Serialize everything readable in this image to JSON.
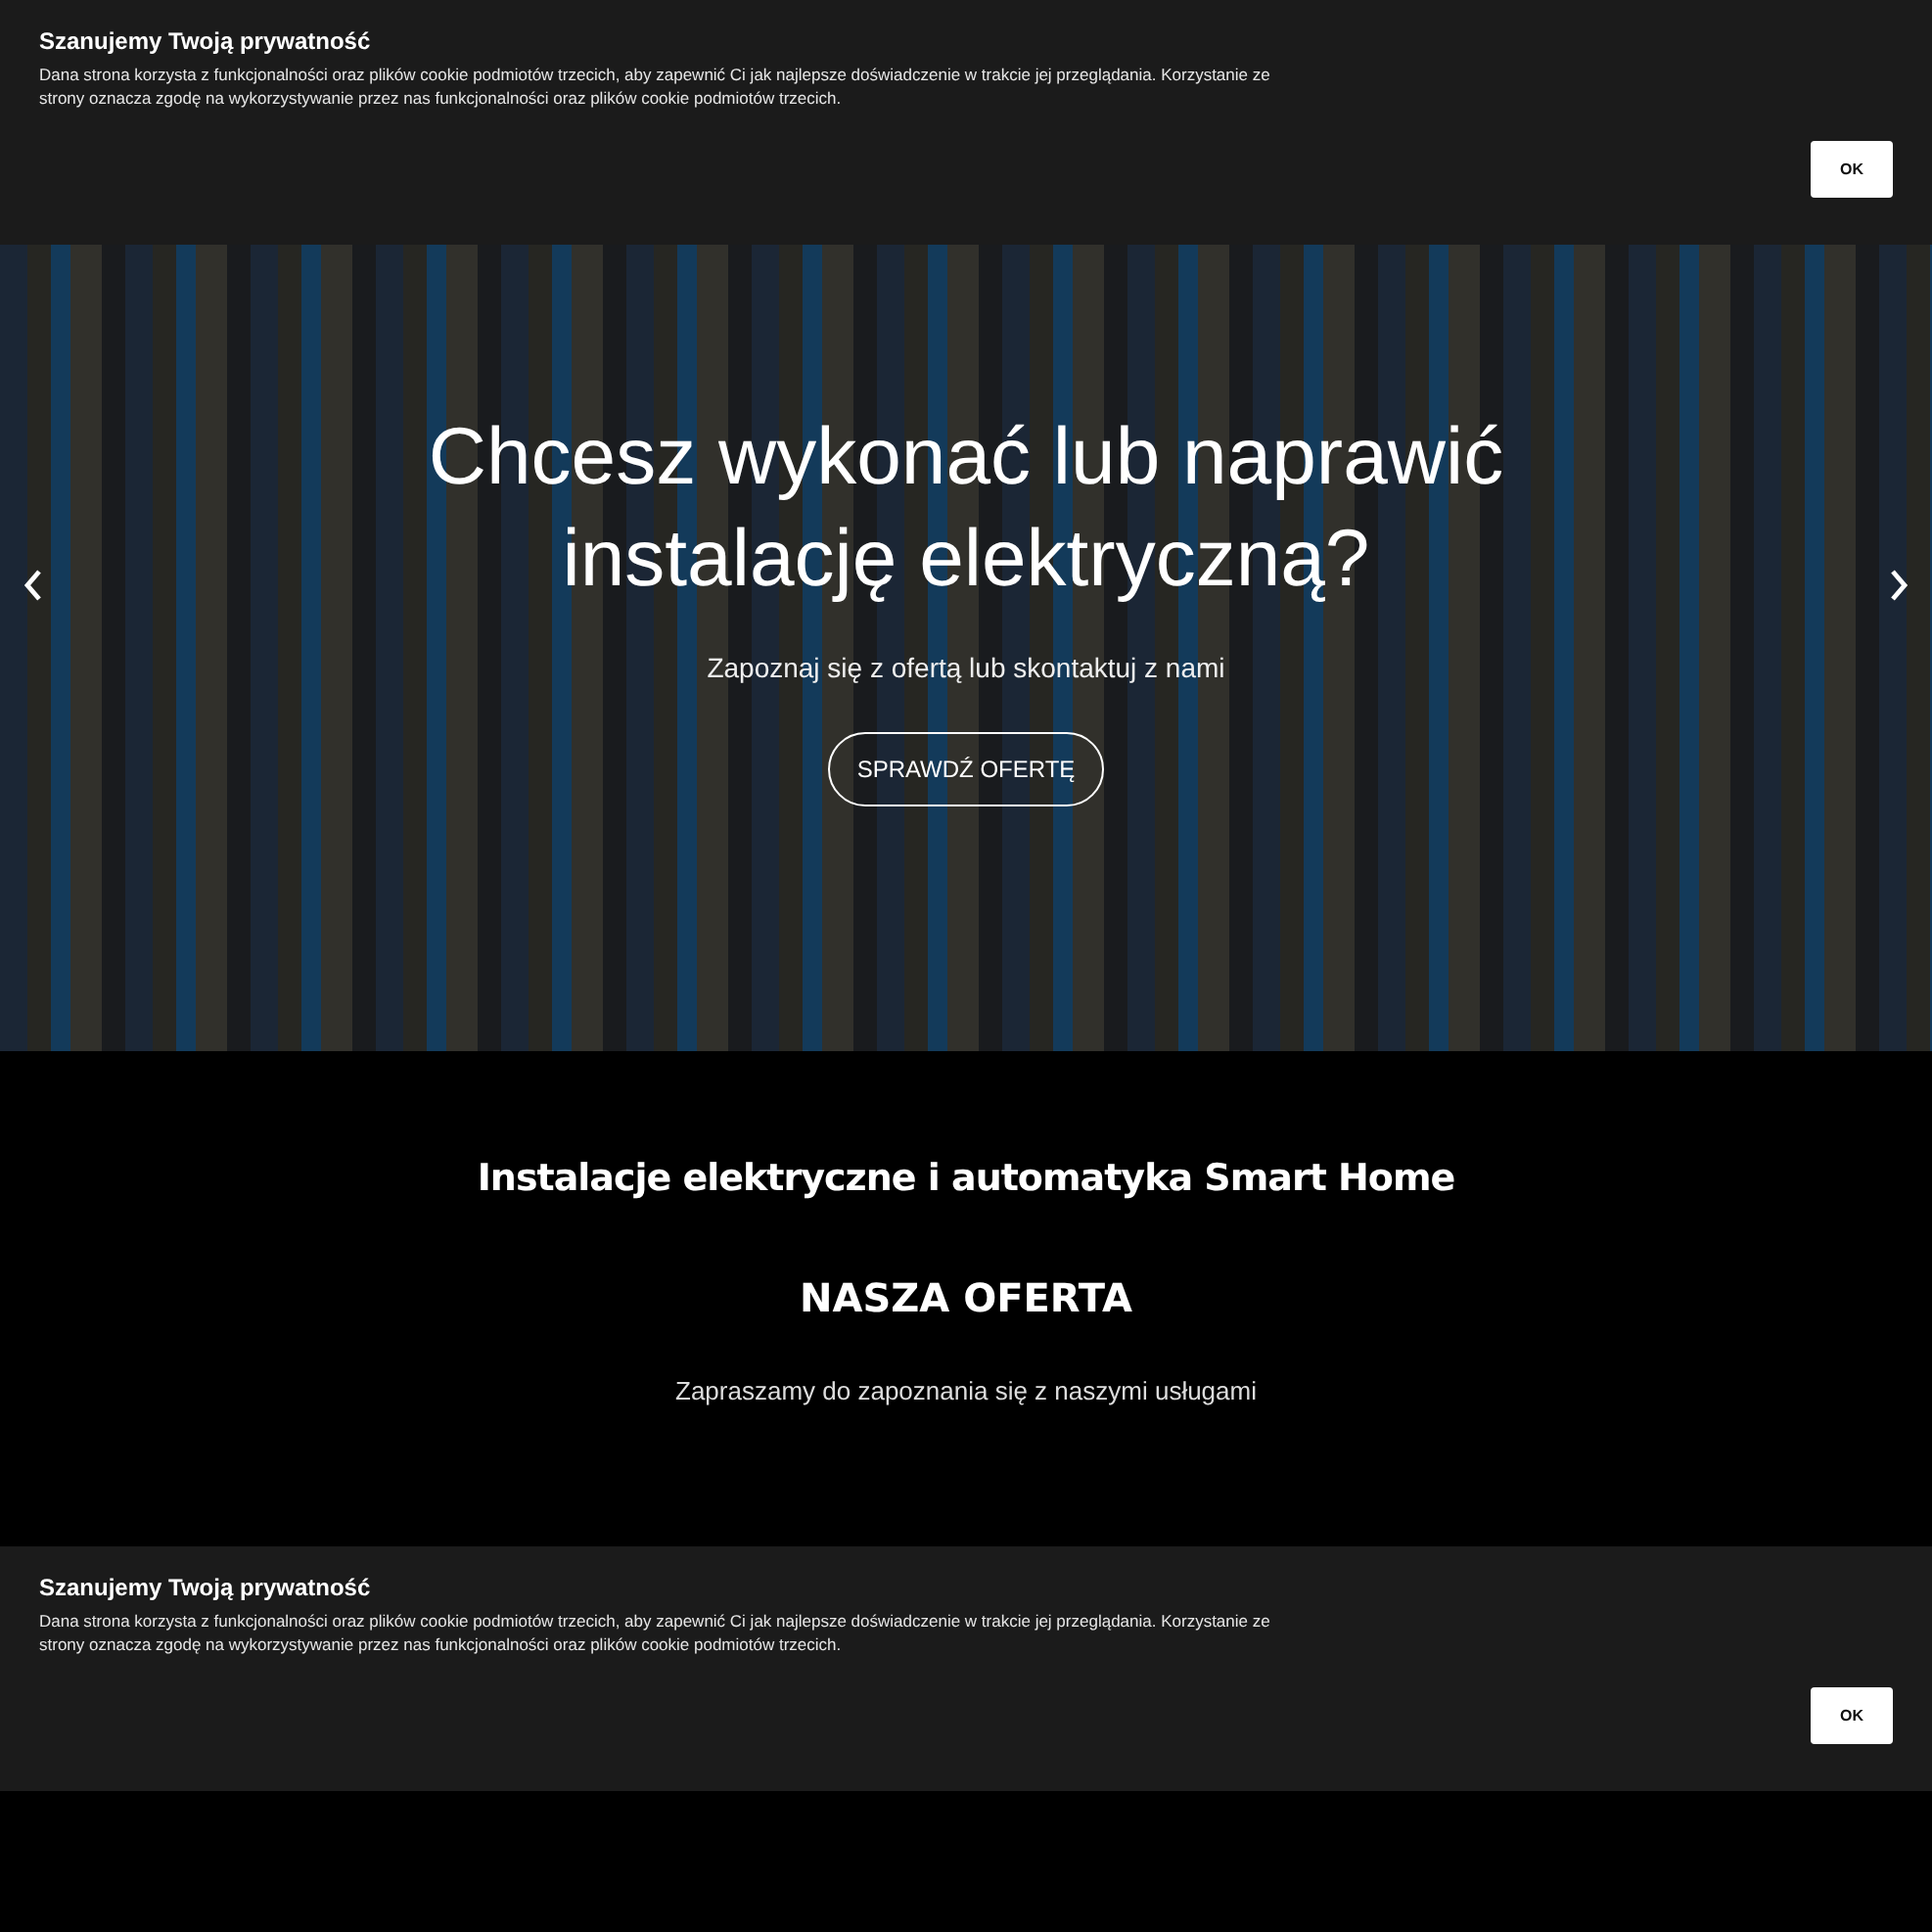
{
  "cookie_banners": [
    {
      "title": "Szanujemy Twoją prywatność",
      "text": "Dana strona korzysta z funkcjonalności oraz plików cookie podmiotów trzecich, aby zapewnić Ci jak najlepsze doświadczenie w trakcie jej przeglądania. Korzystanie ze strony oznacza zgodę na wykorzystywanie przez nas funkcjonalności oraz plików cookie podmiotów trzecich.",
      "button": "OK"
    }
  ],
  "hero": {
    "heading": "Chcesz wykonać lub naprawić instalację elektryczną?",
    "subtitle": "Zapoznaj się z ofertą lub skontaktuj z nami",
    "button": "SPRAWDŹ OFERTĘ"
  },
  "offer": {
    "tagline": "Instalacje elektryczne i automatyka Smart Home",
    "title": "NASZA OFERTA",
    "subtitle": "Zapraszamy do zapoznania się z naszymi usługami"
  },
  "cookie_banner_bottom": {
    "title": "Szanujemy Twoją prywatność",
    "text": "Dana strona korzysta z funkcjonalności oraz plików cookie podmiotów trzecich, aby zapewnić Ci jak najlepsze doświadczenie w trakcie jej przeglądania. Korzystanie ze strony oznacza zgodę na wykorzystywanie przez nas funkcjonalności oraz plików cookie podmiotów trzecich.",
    "button": "OK"
  }
}
